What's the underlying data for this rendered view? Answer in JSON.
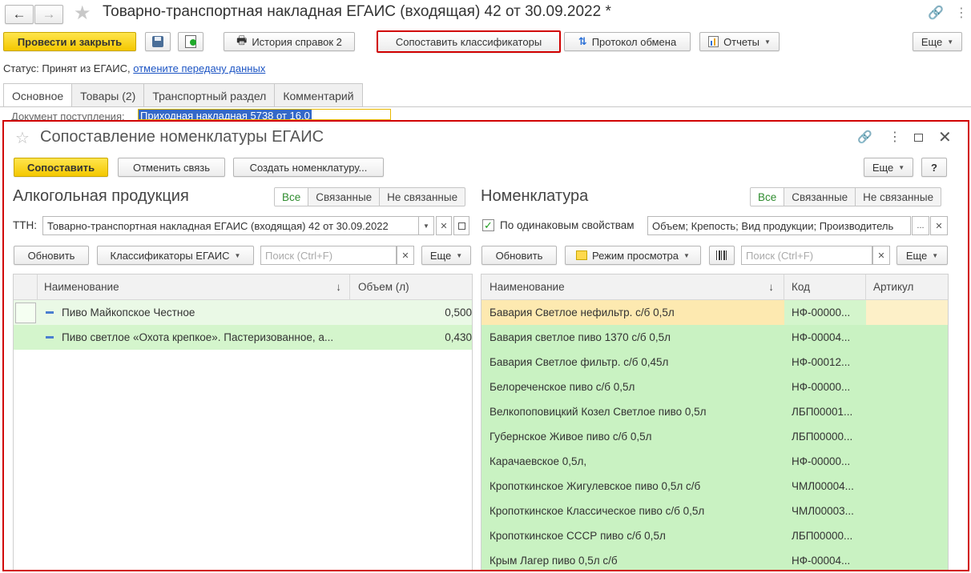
{
  "main": {
    "title": "Товарно-транспортная накладная ЕГАИС (входящая) 42 от 30.09.2022 *",
    "toolbar": {
      "post_close": "Провести и закрыть",
      "history": "История справок 2",
      "map_classifiers": "Сопоставить классификаторы",
      "protocol": "Протокол обмена",
      "reports": "Отчеты",
      "more": "Еще"
    },
    "status_label": "Статус:",
    "status_value": "Принят из ЕГАИС,",
    "status_link": "отмените передачу данных",
    "tabs": [
      "Основное",
      "Товары (2)",
      "Транспортный раздел",
      "Комментарий"
    ],
    "partial_field_label": "Документ поступления:",
    "partial_field_value": "Приходная накладная 5738 от 16.0"
  },
  "dialog": {
    "title": "Сопоставление номенклатуры ЕГАИС",
    "buttons": {
      "map": "Сопоставить",
      "cancel_link": "Отменить связь",
      "create": "Создать номенклатуру...",
      "more": "Еще",
      "help": "?"
    },
    "left": {
      "heading": "Алкогольная продукция",
      "filters": [
        "Все",
        "Связанные",
        "Не связанные"
      ],
      "ttn_label": "ТТН:",
      "ttn_value": "Товарно-транспортная накладная ЕГАИС (входящая) 42 от 30.09.2022",
      "refresh": "Обновить",
      "classifiers": "Классификаторы ЕГАИС",
      "search_placeholder": "Поиск (Ctrl+F)",
      "more": "Еще",
      "columns": [
        "Наименование",
        "Объем (л)"
      ],
      "sort_arrow": "↓",
      "rows": [
        {
          "name": "Пиво Майкопское Честное",
          "volume": "0,500"
        },
        {
          "name": "Пиво светлое «Охота крепкое». Пастеризованное, а...",
          "volume": "0,430"
        }
      ]
    },
    "right": {
      "heading": "Номенклатура",
      "filters": [
        "Все",
        "Связанные",
        "Не связанные"
      ],
      "same_props_label": "По одинаковым свойствам",
      "same_props_value": "Объем; Крепость; Вид продукции; Производитель",
      "ellipsis": "...",
      "refresh": "Обновить",
      "view_mode": "Режим просмотра",
      "search_placeholder": "Поиск (Ctrl+F)",
      "more": "Еще",
      "columns": [
        "Наименование",
        "Код",
        "Артикул"
      ],
      "sort_arrow": "↓",
      "rows": [
        {
          "name": "Бавария Светлое нефильтр. с/б 0,5л",
          "code": "НФ-00000..."
        },
        {
          "name": "Бавария светлое пиво 1370 с/б 0,5л",
          "code": "НФ-00004..."
        },
        {
          "name": "Бавария Светлое фильтр. с/б 0,45л",
          "code": "НФ-00012..."
        },
        {
          "name": "Белореченское пиво с/б 0,5л",
          "code": "НФ-00000..."
        },
        {
          "name": "Велкопоповицкий Козел Светлое пиво 0,5л",
          "code": "ЛБП00001..."
        },
        {
          "name": "Губернское Живое пиво с/б 0,5л",
          "code": "ЛБП00000..."
        },
        {
          "name": "Карачаевское 0,5л,",
          "code": "НФ-00000..."
        },
        {
          "name": "Кропоткинское Жигулевское пиво 0,5л с/б",
          "code": "ЧМЛ00004..."
        },
        {
          "name": "Кропоткинское Классическое пиво с/б 0,5л",
          "code": "ЧМЛ00003..."
        },
        {
          "name": "Кропоткинское СССР пиво с/б 0,5л",
          "code": "ЛБП00000..."
        },
        {
          "name": "Крым Лагер пиво 0,5л с/б",
          "code": "НФ-00004..."
        }
      ]
    }
  },
  "colors": {
    "highlight_red": "#d10000",
    "yellow_button": "#f4c800",
    "link_blue": "#1d55c4",
    "green_row": "#d4f5cc",
    "selected_row": "#fde9b0"
  }
}
